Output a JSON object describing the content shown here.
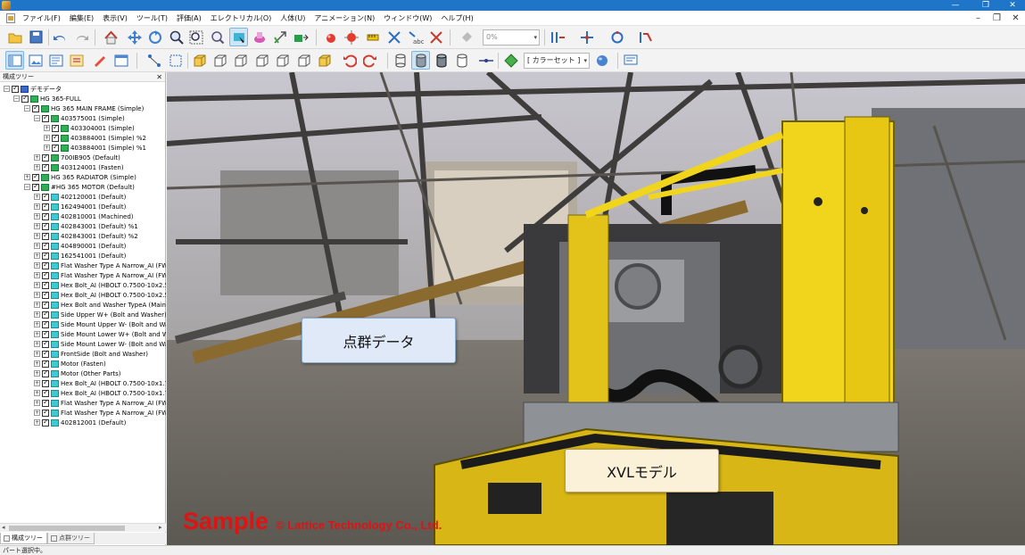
{
  "menu": [
    "ファイル(F)",
    "編集(E)",
    "表示(V)",
    "ツール(T)",
    "評価(A)",
    "エレクトリカル(O)",
    "人体(U)",
    "アニメーション(N)",
    "ウィンドウ(W)",
    "ヘルプ(H)"
  ],
  "toolbar": {
    "opacity_value": "0%",
    "color_set": "[ カラーセット ]"
  },
  "panel": {
    "title": "構成ツリー",
    "tabs": [
      "構成ツリー",
      "点群ツリー"
    ]
  },
  "tree": [
    "デモデータ",
    "HG 365-FULL",
    "HG 365 MAIN FRAME (Simple)",
    "403575001 (Simple)",
    "403304001 (Simple)",
    "403884001 (Simple) %2",
    "403884001 (Simple) %1",
    "700IB905 (Default)",
    "403124001 (Fasten)",
    "HG 365 RADIATOR (Simple)",
    "#HG 365 MOTOR (Default)",
    "402120001 (Default)",
    "162494001 (Default)",
    "402810001 (Machined)",
    "402843001 (Default) %1",
    "402843001 (Default) %2",
    "404890001 (Default)",
    "162541001 (Default)",
    "Flat Washer Type A Narrow_AI (FW-",
    "Flat Washer Type A Narrow_AI (FW-",
    "Hex Bolt_AI (HBOLT 0.7500-10x2.5x",
    "Hex Bolt_AI (HBOLT 0.7500-10x2.5x",
    "Hex Bolt and Washer TypeA (MainF",
    "Side Upper W+ (Bolt and Washer)",
    "Side Mount Upper W- (Bolt and Wa",
    "Side Mount Lower W+ (Bolt and Wa",
    "Side Mount Lower W- (Bolt and Wa",
    "FrontSide (Bolt and Washer)",
    "Motor (Fasten)",
    "Motor (Other Parts)",
    "Hex Bolt_AI (HBOLT 0.7500-10x1.75",
    "Hex Bolt_AI (HBOLT 0.7500-10x1.75",
    "Flat Washer Type A Narrow_AI (FW-",
    "Flat Washer Type A Narrow_AI (FW-",
    "402812001 (Default)"
  ],
  "viewport": {
    "callout_pointcloud": "点群データ",
    "callout_xvl": "XVLモデル",
    "watermark_sample": "Sample",
    "watermark_copyright": "© Lattice Technology Co., Ltd."
  },
  "status": "パート選択中。"
}
